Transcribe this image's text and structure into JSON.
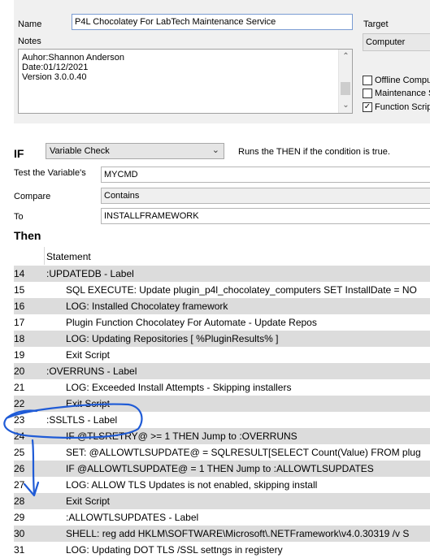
{
  "form": {
    "name_label": "Name",
    "name_value": "P4L Chocolatey For LabTech  Maintenance Service",
    "notes_label": "Notes",
    "notes_lines": [
      "Auhor:Shannon Anderson",
      "Date:01/12/2021",
      "Version 3.0.0.40"
    ],
    "target_label": "Target",
    "target_value": "Computer",
    "checkboxes": [
      {
        "label": "Offline Compu",
        "checked": false
      },
      {
        "label": "Maintenance S",
        "checked": false
      },
      {
        "label": "Function Script",
        "checked": true
      }
    ]
  },
  "condition": {
    "if_label": "IF",
    "type_value": "Variable Check",
    "description": "Runs the THEN if the condition is true.",
    "test_variable_label": "Test the Variable's",
    "test_variable_value": "MYCMD",
    "compare_label": "Compare",
    "compare_value": "Contains",
    "to_label": "To",
    "to_value": "INSTALLFRAMEWORK"
  },
  "then": {
    "label": "Then",
    "column_header": "Statement",
    "rows": [
      {
        "num": "14",
        "text": ":UPDATEDB - Label",
        "indent": 0
      },
      {
        "num": "15",
        "text": "SQL EXECUTE: Update plugin_p4l_chocolatey_computers SET InstallDate = NO",
        "indent": 1
      },
      {
        "num": "16",
        "text": "LOG:  Installed Chocolatey framework",
        "indent": 1
      },
      {
        "num": "17",
        "text": "Plugin Function Chocolatey For Automate - Update Repos",
        "indent": 1
      },
      {
        "num": "18",
        "text": "LOG:  Updating Repositories [ %PluginResults% ]",
        "indent": 1
      },
      {
        "num": "19",
        "text": "Exit Script",
        "indent": 1
      },
      {
        "num": "20",
        "text": ":OVERRUNS - Label",
        "indent": 0
      },
      {
        "num": "21",
        "text": "LOG:  Exceeded Install Attempts - Skipping installers",
        "indent": 1
      },
      {
        "num": "22",
        "text": "Exit Script",
        "indent": 1
      },
      {
        "num": "23",
        "text": ":SSLTLS - Label",
        "indent": 0
      },
      {
        "num": "24",
        "text": "IF  @TLSRETRY@  >=  1  THEN  Jump to :OVERRUNS",
        "indent": 1
      },
      {
        "num": "25",
        "text": "SET:  @ALLOWTLSUPDATE@ = SQLRESULT[SELECT Count(Value) FROM plug",
        "indent": 1
      },
      {
        "num": "26",
        "text": "IF  @ALLOWTLSUPDATE@  =  1  THEN  Jump to :ALLOWTLSUPDATES",
        "indent": 1
      },
      {
        "num": "27",
        "text": "LOG:  ALLOW TLS Updates is not enabled, skipping install",
        "indent": 1
      },
      {
        "num": "28",
        "text": "Exit Script",
        "indent": 1
      },
      {
        "num": "29",
        "text": ":ALLOWTLSUPDATES - Label",
        "indent": 1
      },
      {
        "num": "30",
        "text": "SHELL:  reg add HKLM\\SOFTWARE\\Microsoft\\.NETFramework\\v4.0.30319 /v S",
        "indent": 1
      },
      {
        "num": "31",
        "text": "LOG:  Updating DOT TLS /SSL settngs in registery",
        "indent": 1
      }
    ]
  },
  "colors": {
    "row_alt": "#dcdcdc",
    "annotation": "#1f5bd6"
  }
}
